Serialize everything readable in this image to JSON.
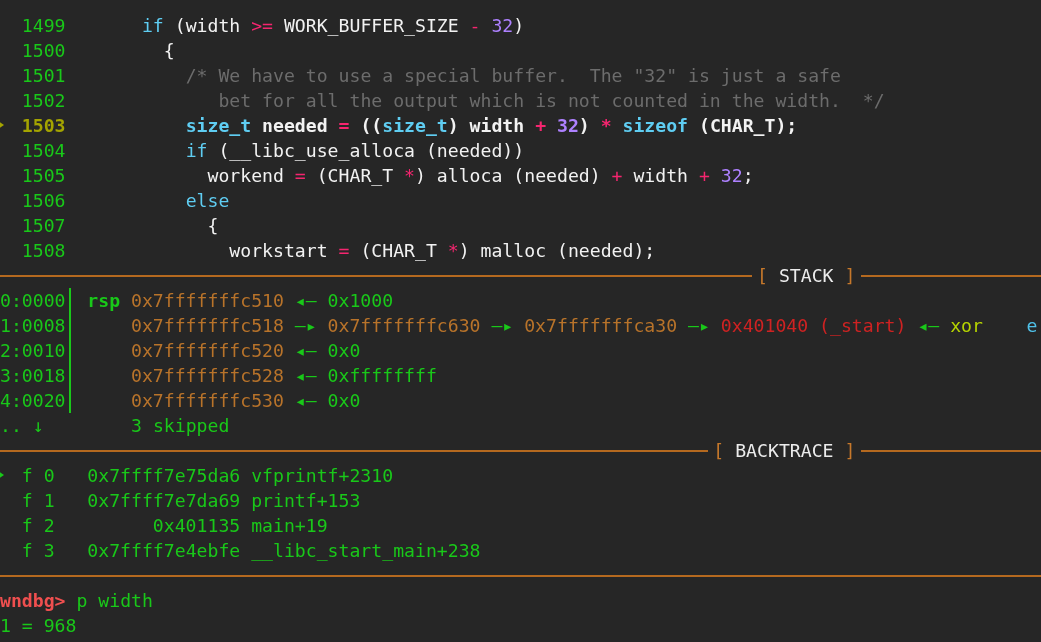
{
  "source": {
    "lines": [
      {
        "number": "1499",
        "current": false,
        "tokens": [
          {
            "text": "       if",
            "kind": "keyword"
          },
          {
            "text": " (width ",
            "kind": "plain"
          },
          {
            "text": ">=",
            "kind": "op"
          },
          {
            "text": " WORK_BUFFER_SIZE ",
            "kind": "plain"
          },
          {
            "text": "-",
            "kind": "op"
          },
          {
            "text": " 32",
            "kind": "number"
          },
          {
            "text": ")",
            "kind": "plain"
          }
        ]
      },
      {
        "number": "1500",
        "current": false,
        "tokens": [
          {
            "text": "         {",
            "kind": "plain"
          }
        ]
      },
      {
        "number": "1501",
        "current": false,
        "tokens": [
          {
            "text": "           /* We have to use a special buffer.  The \"32\" is just a safe",
            "kind": "comment"
          }
        ]
      },
      {
        "number": "1502",
        "current": false,
        "tokens": [
          {
            "text": "              bet for all the output which is not counted in the width.  */",
            "kind": "comment"
          }
        ]
      },
      {
        "number": "1503",
        "current": true,
        "tokens": [
          {
            "text": "           size_t",
            "kind": "type"
          },
          {
            "text": " needed",
            "kind": "plain"
          },
          {
            "text": " =",
            "kind": "op"
          },
          {
            "text": " ((",
            "kind": "plain"
          },
          {
            "text": "size_t",
            "kind": "type"
          },
          {
            "text": ") width",
            "kind": "plain"
          },
          {
            "text": " +",
            "kind": "op"
          },
          {
            "text": " 32",
            "kind": "number"
          },
          {
            "text": ")",
            "kind": "plain"
          },
          {
            "text": " *",
            "kind": "op"
          },
          {
            "text": " sizeof",
            "kind": "type"
          },
          {
            "text": " (CHAR_T);",
            "kind": "plain"
          }
        ]
      },
      {
        "number": "1504",
        "current": false,
        "tokens": [
          {
            "text": "           if",
            "kind": "keyword"
          },
          {
            "text": " (__libc_use_alloca (needed))",
            "kind": "plain"
          }
        ]
      },
      {
        "number": "1505",
        "current": false,
        "tokens": [
          {
            "text": "             workend",
            "kind": "plain"
          },
          {
            "text": " =",
            "kind": "op"
          },
          {
            "text": " (CHAR_T ",
            "kind": "plain"
          },
          {
            "text": "*",
            "kind": "op"
          },
          {
            "text": ") alloca (needed) ",
            "kind": "plain"
          },
          {
            "text": "+",
            "kind": "op"
          },
          {
            "text": " width ",
            "kind": "plain"
          },
          {
            "text": "+",
            "kind": "op"
          },
          {
            "text": " 32",
            "kind": "number"
          },
          {
            "text": ";",
            "kind": "plain"
          }
        ]
      },
      {
        "number": "1506",
        "current": false,
        "tokens": [
          {
            "text": "           else",
            "kind": "keyword"
          }
        ]
      },
      {
        "number": "1507",
        "current": false,
        "tokens": [
          {
            "text": "             {",
            "kind": "plain"
          }
        ]
      },
      {
        "number": "1508",
        "current": false,
        "tokens": [
          {
            "text": "               workstart",
            "kind": "plain"
          },
          {
            "text": " =",
            "kind": "op"
          },
          {
            "text": " (CHAR_T ",
            "kind": "plain"
          },
          {
            "text": "*",
            "kind": "op"
          },
          {
            "text": ") malloc (needed);",
            "kind": "plain"
          }
        ]
      }
    ]
  },
  "stack": {
    "header": {
      "open": "[",
      "title": "STACK",
      "close": "]"
    },
    "rows": [
      {
        "offset": "0:0000",
        "register": "rsp",
        "chain": [
          {
            "text": "0x7fffffffc510",
            "kind": "stack"
          },
          {
            "text": "◂—",
            "kind": "arrow"
          },
          {
            "text": "0x1000",
            "kind": "value"
          }
        ]
      },
      {
        "offset": "1:0008",
        "chain": [
          {
            "text": "0x7fffffffc518",
            "kind": "stack"
          },
          {
            "text": "—▸",
            "kind": "arrow"
          },
          {
            "text": "0x7fffffffc630",
            "kind": "stack"
          },
          {
            "text": "—▸",
            "kind": "arrow"
          },
          {
            "text": "0x7fffffffca30",
            "kind": "stack"
          },
          {
            "text": "—▸",
            "kind": "arrow"
          },
          {
            "text": "0x401040 (_start)",
            "kind": "code"
          },
          {
            "text": "◂—",
            "kind": "arrow"
          },
          {
            "text": "xor",
            "kind": "mnemonic"
          },
          {
            "text": "e",
            "kind": "operand"
          }
        ]
      },
      {
        "offset": "2:0010",
        "chain": [
          {
            "text": "0x7fffffffc520",
            "kind": "stack"
          },
          {
            "text": "◂—",
            "kind": "arrow"
          },
          {
            "text": "0x0",
            "kind": "value"
          }
        ]
      },
      {
        "offset": "3:0018",
        "chain": [
          {
            "text": "0x7fffffffc528",
            "kind": "stack"
          },
          {
            "text": "◂—",
            "kind": "arrow"
          },
          {
            "text": "0xffffffff",
            "kind": "value"
          }
        ]
      },
      {
        "offset": "4:0020",
        "chain": [
          {
            "text": "0x7fffffffc530",
            "kind": "stack"
          },
          {
            "text": "◂—",
            "kind": "arrow"
          },
          {
            "text": "0x0",
            "kind": "value"
          }
        ]
      }
    ],
    "skipped": {
      "indicator": ".. ↓",
      "text": "3 skipped"
    }
  },
  "backtrace": {
    "header": {
      "open": "[",
      "title": "BACKTRACE",
      "close": "]"
    },
    "frames": [
      {
        "frame": "f 0",
        "address": "0x7ffff7e75da6",
        "symbol": "vfprintf+2310",
        "selected": true
      },
      {
        "frame": "f 1",
        "address": "0x7ffff7e7da69",
        "symbol": "printf+153",
        "selected": false
      },
      {
        "frame": "f 2",
        "address": "0x401135",
        "symbol": "main+19",
        "selected": false
      },
      {
        "frame": "f 3",
        "address": "0x7ffff7e4ebfe",
        "symbol": "__libc_start_main+238",
        "selected": false
      }
    ]
  },
  "console": {
    "prompt": "wndbg>",
    "command": "p width",
    "output": "1 = 968"
  }
}
